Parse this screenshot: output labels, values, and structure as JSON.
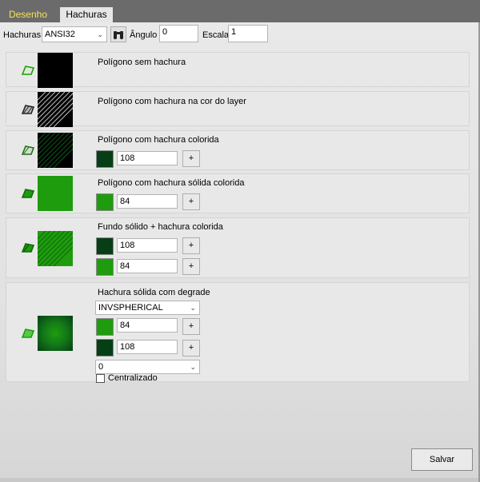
{
  "tabs": [
    {
      "label": "Desenho",
      "active": true
    },
    {
      "label": "Hachuras",
      "active": false
    }
  ],
  "toolbar": {
    "hachuras_label": "Hachuras",
    "hachuras_value": "ANSI32",
    "angulo_label": "Ângulo",
    "angulo_value": "0",
    "escala_label": "Escala",
    "escala_value": "1"
  },
  "panels": [
    {
      "title": "Polígono sem hachura"
    },
    {
      "title": "Polígono com hachura na cor do layer"
    },
    {
      "title": "Polígono com hachura colorida",
      "colors": [
        {
          "value": "108",
          "swatch": "#063f16"
        }
      ]
    },
    {
      "title": "Polígono com hachura sólida colorida",
      "colors": [
        {
          "value": "84",
          "swatch": "#1f9c0e"
        }
      ]
    },
    {
      "title": "Fundo sólido + hachura colorida",
      "colors": [
        {
          "value": "108",
          "swatch": "#063f16"
        },
        {
          "value": "84",
          "swatch": "#1f9c0e"
        }
      ]
    },
    {
      "title": "Hachura sólida com degrade",
      "gradient_type": "INVSPHERICAL",
      "colors": [
        {
          "value": "84",
          "swatch": "#1f9c0e"
        },
        {
          "value": "108",
          "swatch": "#063f16"
        }
      ],
      "angle_value": "0",
      "centralizado_label": "Centralizado",
      "centralizado_checked": false
    }
  ],
  "plus_label": "+",
  "save_label": "Salvar",
  "colors": {
    "dark_green": "#063f16",
    "light_green": "#1f9c0e",
    "tab_active_text": "#f6e35a",
    "tab_bar": "#6b6b6b"
  },
  "icons": [
    "binoculars-icon",
    "polygon-icon",
    "chevron-down-icon"
  ]
}
